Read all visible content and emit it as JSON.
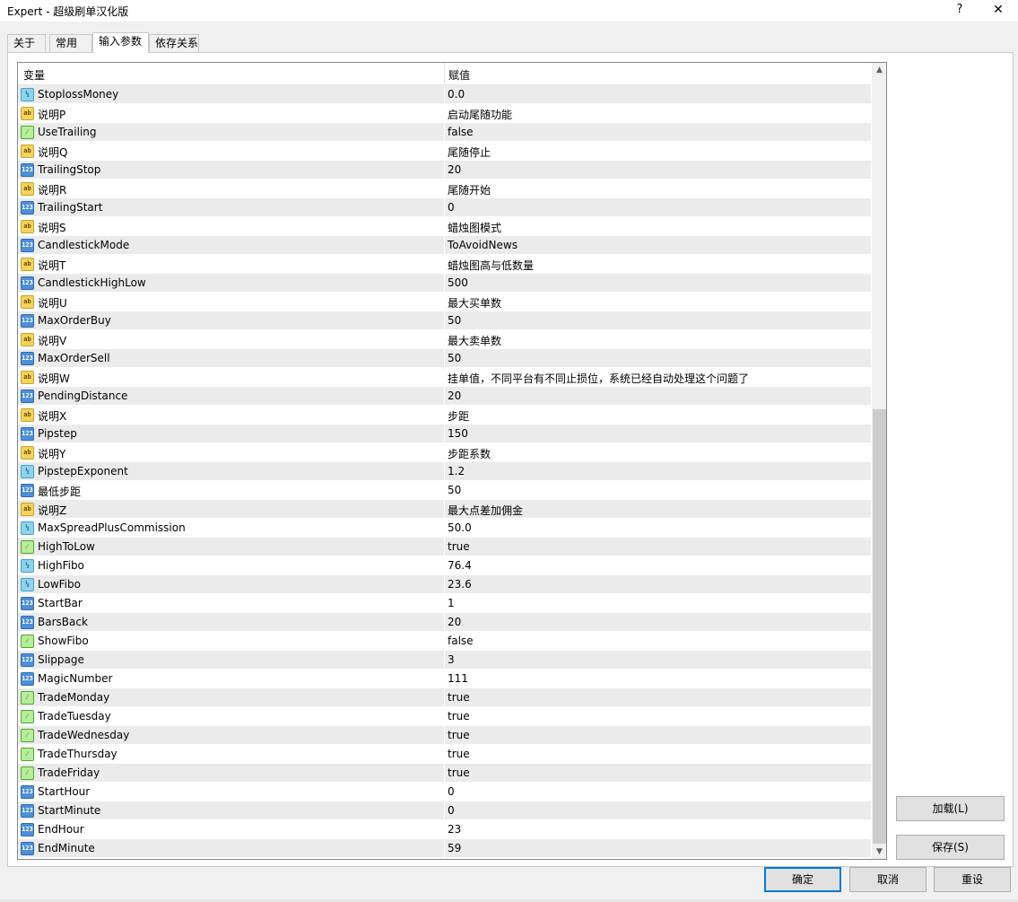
{
  "window": {
    "title": "Expert - 超级刷单汉化版",
    "help_label": "?",
    "close_label": "✕"
  },
  "tabs": [
    {
      "label": "关于"
    },
    {
      "label": "常用"
    },
    {
      "label": "输入参数",
      "active": true
    },
    {
      "label": "依存关系"
    }
  ],
  "grid": {
    "headers": {
      "name": "变量",
      "value": "赋值"
    },
    "type_icons": {
      "str": "string-type-icon",
      "int": "integer-type-icon",
      "dbl": "double-type-icon",
      "bool": "bool-type-icon"
    },
    "type_glyphs": {
      "str": "ab",
      "int": "123",
      "dbl": "½",
      "bool": "⁄"
    },
    "rows": [
      {
        "type": "dbl",
        "name": "StoplossMoney",
        "value": "0.0"
      },
      {
        "type": "str",
        "name": "说明P",
        "value": "启动尾随功能"
      },
      {
        "type": "bool",
        "name": "UseTrailing",
        "value": "false"
      },
      {
        "type": "str",
        "name": "说明Q",
        "value": "尾随停止"
      },
      {
        "type": "int",
        "name": "TrailingStop",
        "value": "20"
      },
      {
        "type": "str",
        "name": "说明R",
        "value": "尾随开始"
      },
      {
        "type": "int",
        "name": "TrailingStart",
        "value": "0"
      },
      {
        "type": "str",
        "name": "说明S",
        "value": "蜡烛图模式"
      },
      {
        "type": "int",
        "name": "CandlestickMode",
        "value": "ToAvoidNews"
      },
      {
        "type": "str",
        "name": "说明T",
        "value": "蜡烛图高与低数量"
      },
      {
        "type": "int",
        "name": "CandlestickHighLow",
        "value": "500"
      },
      {
        "type": "str",
        "name": "说明U",
        "value": "最大买单数"
      },
      {
        "type": "int",
        "name": "MaxOrderBuy",
        "value": "50"
      },
      {
        "type": "str",
        "name": "说明V",
        "value": "最大卖单数"
      },
      {
        "type": "int",
        "name": "MaxOrderSell",
        "value": "50"
      },
      {
        "type": "str",
        "name": "说明W",
        "value": "挂单值，不同平台有不同止损位，系统已经自动处理这个问题了"
      },
      {
        "type": "int",
        "name": "PendingDistance",
        "value": "20"
      },
      {
        "type": "str",
        "name": "说明X",
        "value": "步距"
      },
      {
        "type": "int",
        "name": "Pipstep",
        "value": "150"
      },
      {
        "type": "str",
        "name": "说明Y",
        "value": "步距系数"
      },
      {
        "type": "dbl",
        "name": "PipstepExponent",
        "value": "1.2"
      },
      {
        "type": "int",
        "name": "最低步距",
        "value": "50"
      },
      {
        "type": "str",
        "name": "说明Z",
        "value": "最大点差加佣金"
      },
      {
        "type": "dbl",
        "name": "MaxSpreadPlusCommission",
        "value": "50.0"
      },
      {
        "type": "bool",
        "name": "HighToLow",
        "value": "true"
      },
      {
        "type": "dbl",
        "name": "HighFibo",
        "value": "76.4"
      },
      {
        "type": "dbl",
        "name": "LowFibo",
        "value": "23.6"
      },
      {
        "type": "int",
        "name": "StartBar",
        "value": "1"
      },
      {
        "type": "int",
        "name": "BarsBack",
        "value": "20"
      },
      {
        "type": "bool",
        "name": "ShowFibo",
        "value": "false"
      },
      {
        "type": "int",
        "name": "Slippage",
        "value": "3"
      },
      {
        "type": "int",
        "name": "MagicNumber",
        "value": "111"
      },
      {
        "type": "bool",
        "name": "TradeMonday",
        "value": "true"
      },
      {
        "type": "bool",
        "name": "TradeTuesday",
        "value": "true"
      },
      {
        "type": "bool",
        "name": "TradeWednesday",
        "value": "true"
      },
      {
        "type": "bool",
        "name": "TradeThursday",
        "value": "true"
      },
      {
        "type": "bool",
        "name": "TradeFriday",
        "value": "true"
      },
      {
        "type": "int",
        "name": "StartHour",
        "value": "0"
      },
      {
        "type": "int",
        "name": "StartMinute",
        "value": "0"
      },
      {
        "type": "int",
        "name": "EndHour",
        "value": "23"
      },
      {
        "type": "int",
        "name": "EndMinute",
        "value": "59"
      }
    ]
  },
  "side_buttons": {
    "load": "加载(L)",
    "save": "保存(S)"
  },
  "footer_buttons": {
    "ok": "确定",
    "cancel": "取消",
    "reset": "重设"
  },
  "colors": {
    "accent": "#0078d7",
    "row_alt": "#ebebeb"
  }
}
